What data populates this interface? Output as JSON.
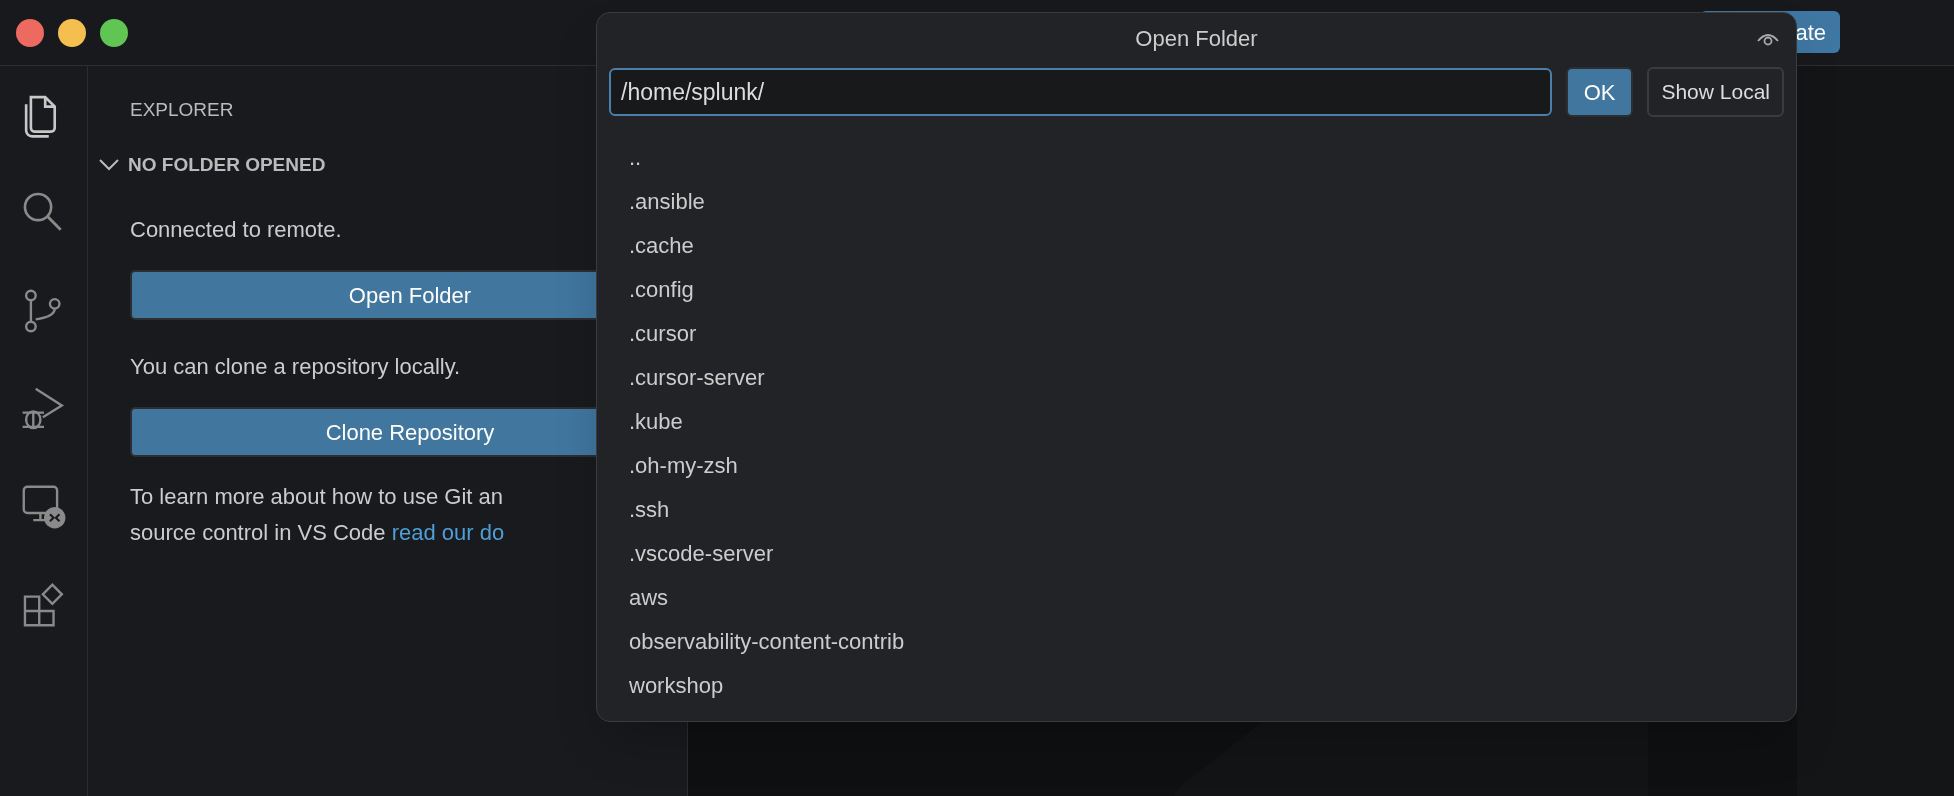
{
  "title_bar": {
    "button": "ate"
  },
  "activity_bar": [
    {
      "kind": "files",
      "selected": true
    },
    {
      "kind": "search",
      "selected": false
    },
    {
      "kind": "source-control",
      "selected": false
    },
    {
      "kind": "run-debug",
      "selected": false
    },
    {
      "kind": "remote",
      "selected": false
    },
    {
      "kind": "extensions",
      "selected": false
    }
  ],
  "sidebar": {
    "title": "EXPLORER",
    "section": {
      "label": "NO FOLDER OPENED",
      "expanded": true
    },
    "content": [
      {
        "kind": "text",
        "text": "Connected to remote."
      },
      {
        "kind": "button",
        "text": "Open Folder"
      },
      {
        "kind": "text",
        "text": "You can clone a repository locally."
      },
      {
        "kind": "button",
        "text": "Clone Repository"
      },
      {
        "kind": "paragraph",
        "lines": [
          "To learn more about how to use Git an",
          "source control in VS Code "
        ],
        "link": "read our do"
      }
    ]
  },
  "dialog": {
    "title": "Open Folder",
    "path": "/home/splunk/",
    "buttons": [
      {
        "label": "OK",
        "primary": true
      },
      {
        "label": "Show Local",
        "primary": false
      }
    ],
    "items": [
      {
        "label": ".."
      },
      {
        "label": ".ansible"
      },
      {
        "label": ".cache"
      },
      {
        "label": ".config"
      },
      {
        "label": ".cursor"
      },
      {
        "label": ".cursor-server"
      },
      {
        "label": ".kube"
      },
      {
        "label": ".oh-my-zsh"
      },
      {
        "label": ".ssh"
      },
      {
        "label": ".vscode-server"
      },
      {
        "label": "aws"
      },
      {
        "label": "observability-content-contrib"
      },
      {
        "label": "workshop"
      }
    ]
  }
}
